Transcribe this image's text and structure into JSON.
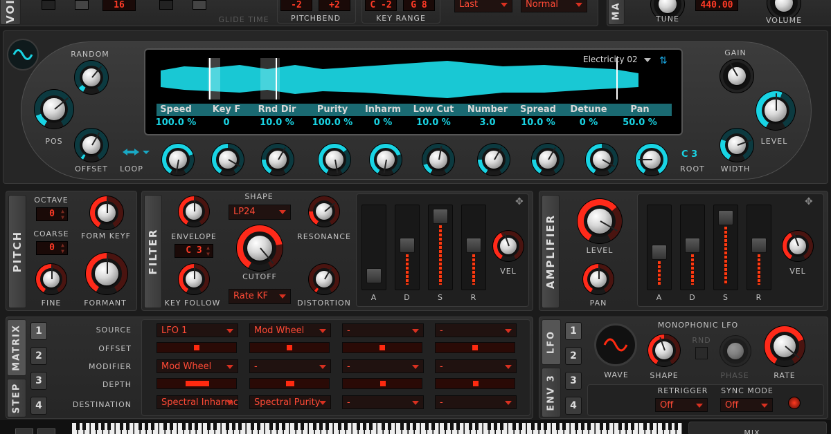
{
  "top_strip": {
    "left_vertical_label": "VOI",
    "display_16": "16",
    "glide_time": "GLIDE TIME",
    "pitchbend": {
      "label": "PITCHBEND",
      "down": "-2",
      "up": "+2"
    },
    "key_range": {
      "label": "KEY RANGE",
      "low": "C -2",
      "high": "G 8"
    },
    "priority_select": "Last",
    "mode_select": "Normal",
    "right_vertical_label": "MA",
    "tune": {
      "label": "TUNE",
      "value": "440.00"
    },
    "volume": {
      "label": "VOLUME"
    }
  },
  "oscillator": {
    "random_label": "RANDOM",
    "pos_label": "POS",
    "offset_label": "OFFSET",
    "loop_label": "LOOP",
    "gain_label": "GAIN",
    "level_label": "LEVEL",
    "width_label": "WIDTH",
    "root_label": "ROOT",
    "root_value": "C 3",
    "sample_name": "Electricity 02",
    "params": [
      {
        "name": "Speed",
        "value": "100.0 %"
      },
      {
        "name": "Key F",
        "value": "0"
      },
      {
        "name": "Rnd Dir",
        "value": "10.0 %"
      },
      {
        "name": "Purity",
        "value": "100.0 %"
      },
      {
        "name": "Inharm",
        "value": "0 %"
      },
      {
        "name": "Low Cut",
        "value": "10.0 %"
      },
      {
        "name": "Number",
        "value": "3.0"
      },
      {
        "name": "Spread",
        "value": "10.0 %"
      },
      {
        "name": "Detune",
        "value": "0 %"
      },
      {
        "name": "Pan",
        "value": "50.0 %"
      }
    ]
  },
  "pitch": {
    "title": "PITCH",
    "octave_label": "OCTAVE",
    "octave_value": "0",
    "coarse_label": "COARSE",
    "coarse_value": "0",
    "fine_label": "FINE",
    "form_keyf_label": "FORM KEYF",
    "formant_label": "FORMANT"
  },
  "filter": {
    "title": "FILTER",
    "envelope_label": "ENVELOPE",
    "envelope_value": "C 3",
    "key_follow_label": "KEY FOLLOW",
    "shape_label": "SHAPE",
    "shape_value": "LP24",
    "cutoff_label": "CUTOFF",
    "mode_value": "Rate KF",
    "resonance_label": "RESONANCE",
    "distortion_label": "DISTORTION",
    "adsr": [
      "A",
      "D",
      "S",
      "R"
    ],
    "vel_label": "VEL"
  },
  "amplifier": {
    "title": "AMPLIFIER",
    "level_label": "LEVEL",
    "pan_label": "PAN",
    "adsr": [
      "A",
      "D",
      "S",
      "R"
    ],
    "vel_label": "VEL"
  },
  "matrix": {
    "tab_matrix": "MATRIX",
    "tab_step": "STEP",
    "numbers": [
      "1",
      "2",
      "3",
      "4"
    ],
    "rows": {
      "source": "SOURCE",
      "offset": "OFFSET",
      "modifier": "MODIFIER",
      "depth": "DEPTH",
      "destination": "DESTINATION"
    },
    "slots": [
      {
        "source": "LFO 1",
        "modifier": "Mod Wheel",
        "destination": "Spectral Inharmc",
        "offset": 0.5,
        "depth": 0.65
      },
      {
        "source": "Mod Wheel",
        "modifier": "-",
        "destination": "Spectral Purity",
        "offset": 0.5,
        "depth": 0.55
      },
      {
        "source": "-",
        "modifier": "-",
        "destination": "-",
        "offset": 0.5,
        "depth": 0.5
      },
      {
        "source": "-",
        "modifier": "-",
        "destination": "-",
        "offset": 0.5,
        "depth": 0.5
      }
    ]
  },
  "lfo": {
    "tab_lfo": "LFO",
    "tab_env": "ENV 3",
    "numbers": [
      "1",
      "2",
      "3",
      "4"
    ],
    "title": "MONOPHONIC LFO",
    "wave_label": "WAVE",
    "shape_label": "SHAPE",
    "rnd_label": "RND",
    "phase_label": "PHASE",
    "rate_label": "RATE",
    "retrigger_label": "RETRIGGER",
    "retrigger_value": "Off",
    "sync_label": "SYNC MODE",
    "sync_value": "Off"
  },
  "bottom": {
    "mix_label": "MIX"
  },
  "colors": {
    "accent_cyan": "#19d4e4",
    "accent_red": "#ff2a10",
    "panel": "#2a2a2a"
  }
}
